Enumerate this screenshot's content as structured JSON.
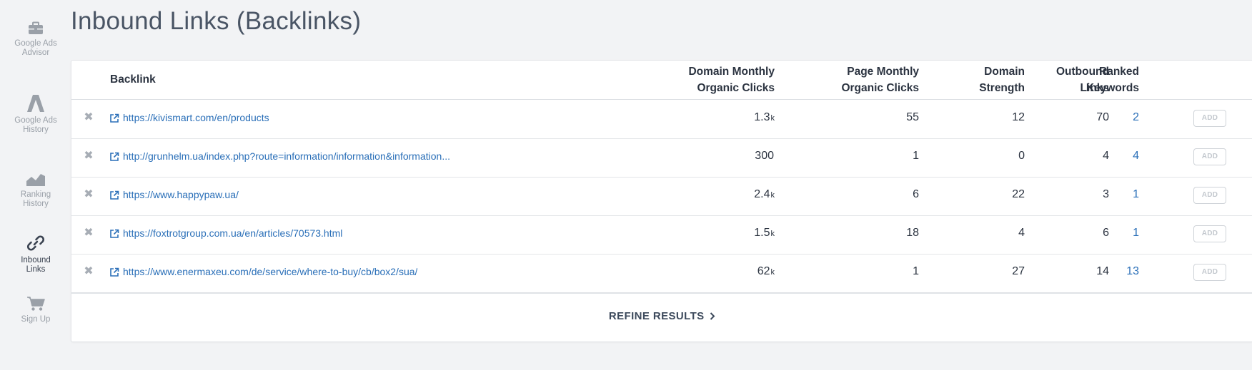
{
  "page": {
    "title": "Inbound Links (Backlinks)"
  },
  "sidebar": {
    "items": [
      {
        "label": "Google Ads Advisor",
        "icon": "briefcase-icon",
        "active": false
      },
      {
        "label": "Google Ads History",
        "icon": "google-ads-logo-icon",
        "active": false
      },
      {
        "label": "Ranking History",
        "icon": "area-chart-icon",
        "active": false
      },
      {
        "label": "Inbound Links",
        "icon": "link-icon",
        "active": true
      },
      {
        "label": "Sign Up",
        "icon": "cart-icon",
        "active": false
      }
    ]
  },
  "table": {
    "headers": {
      "backlink": "Backlink",
      "domain_clicks_1": "Domain Monthly",
      "domain_clicks_2": "Organic Clicks",
      "page_clicks_1": "Page Monthly",
      "page_clicks_2": "Organic Clicks",
      "strength_1": "Domain",
      "strength_2": "Strength",
      "ranked_1": "Ranked",
      "ranked_2": "Keywords",
      "outbound_1": "Outbound",
      "outbound_2": "Links"
    },
    "rows": [
      {
        "url": "https://kivismart.com/en/products",
        "domain_clicks": "1.3",
        "domain_clicks_unit": "k",
        "page_clicks": "55",
        "strength": "12",
        "ranked": "2",
        "outbound": "70",
        "add": "ADD"
      },
      {
        "url": "http://grunhelm.ua/index.php?route=information/information&information...",
        "domain_clicks": "300",
        "domain_clicks_unit": "",
        "page_clicks": "1",
        "strength": "0",
        "ranked": "4",
        "outbound": "4",
        "add": "ADD"
      },
      {
        "url": "https://www.happypaw.ua/",
        "domain_clicks": "2.4",
        "domain_clicks_unit": "k",
        "page_clicks": "6",
        "strength": "22",
        "ranked": "1",
        "outbound": "3",
        "add": "ADD"
      },
      {
        "url": "https://foxtrotgroup.com.ua/en/articles/70573.html",
        "domain_clicks": "1.5",
        "domain_clicks_unit": "k",
        "page_clicks": "18",
        "strength": "4",
        "ranked": "1",
        "outbound": "6",
        "add": "ADD"
      },
      {
        "url": "https://www.enermaxeu.com/de/service/where-to-buy/cb/box2/sua/",
        "domain_clicks": "62",
        "domain_clicks_unit": "k",
        "page_clicks": "1",
        "strength": "27",
        "ranked": "13",
        "outbound": "14",
        "add": "ADD"
      }
    ]
  },
  "footer": {
    "refine_label": "REFINE RESULTS"
  },
  "colors": {
    "link": "#2a6fb8",
    "muted": "#9aa0a8",
    "text": "#2b3340",
    "background": "#f2f3f5"
  }
}
